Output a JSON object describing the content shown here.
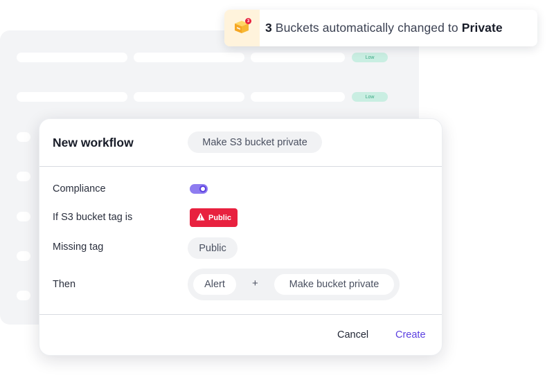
{
  "notification": {
    "icon": "box-icon",
    "badge_count": "3",
    "count": "3",
    "message": " Buckets automatically changed to ",
    "target": "Private",
    "accent_bg": "#fff3dc"
  },
  "background_table": {
    "badges": [
      "Low",
      "Low"
    ]
  },
  "modal": {
    "title": "New workflow",
    "name_chip": "Make S3 bucket private",
    "fields": {
      "compliance_label": "Compliance",
      "compliance_enabled": true,
      "tag_label": "If S3 bucket tag is",
      "tag_value": "Public",
      "missing_label": "Missing tag",
      "missing_value": "Public",
      "then_label": "Then",
      "then_action_1": "Alert",
      "then_joiner": "+",
      "then_action_2": "Make bucket private"
    },
    "footer": {
      "cancel_label": "Cancel",
      "create_label": "Create"
    }
  },
  "colors": {
    "accent": "#5b3fe0",
    "toggle_on": "#8e7cf0",
    "danger": "#e8213f",
    "low_badge_bg": "#c9eee2",
    "low_badge_text": "#3aa883"
  }
}
